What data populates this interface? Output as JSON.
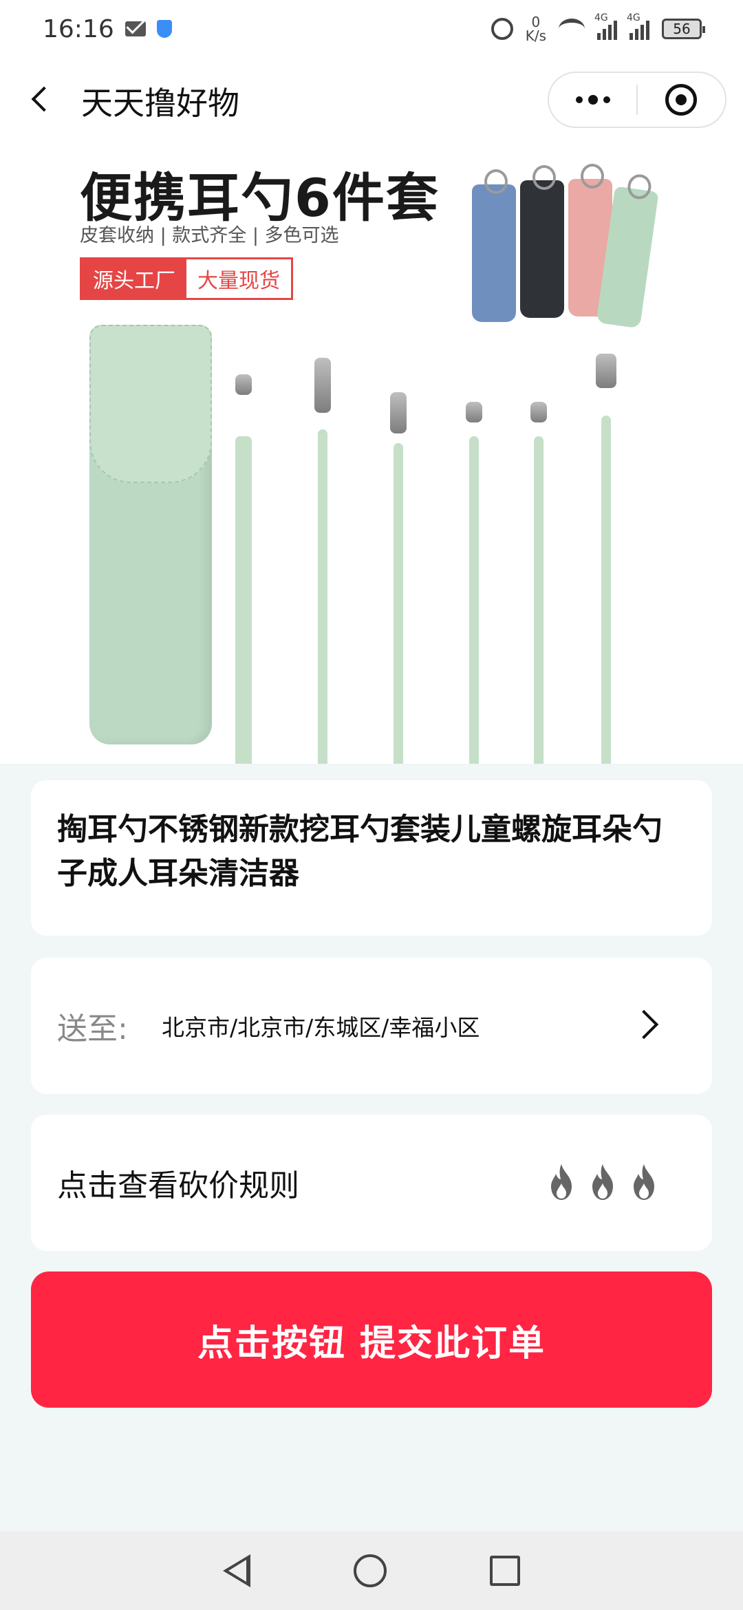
{
  "status_bar": {
    "time": "16:16",
    "net_speed_value": "0",
    "net_speed_unit": "K/s",
    "signal_1_tag": "4G",
    "signal_2_tag": "4G",
    "battery": "56"
  },
  "nav": {
    "title": "天天撸好物"
  },
  "product_image": {
    "headline": "便携耳勺6件套",
    "subtitle": "皮套收纳 | 款式齐全 | 多色可选",
    "tag_red": "源头工厂",
    "tag_white": "大量现货",
    "pouch_colors": [
      "#6f8fbf",
      "#2f3338",
      "#eaa9a4",
      "#b8d9bf"
    ]
  },
  "product": {
    "title": "掏耳勺不锈钢新款挖耳勺套装儿童螺旋耳朵勺子成人耳朵清洁器"
  },
  "address": {
    "label": "送至:",
    "value": "北京市/北京市/东城区/幸福小区"
  },
  "rules": {
    "label": "点击查看砍价规则",
    "icons": [
      "fire-icon",
      "fire-icon",
      "fire-icon"
    ]
  },
  "submit": {
    "label": "点击按钮 提交此订单",
    "color": "#ff2543"
  }
}
